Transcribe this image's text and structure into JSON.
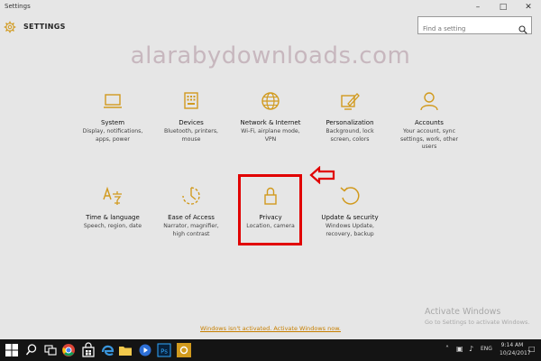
{
  "window": {
    "title": "Settings"
  },
  "header": {
    "title": "SETTINGS"
  },
  "search": {
    "placeholder": "Find a setting"
  },
  "watermark": "alarabydownloads.com",
  "accent": "#d19a1e",
  "tiles": [
    {
      "icon": "laptop-icon",
      "name": "System",
      "desc": [
        "Display, notifications,",
        "apps, power"
      ]
    },
    {
      "icon": "devices-icon",
      "name": "Devices",
      "desc": [
        "Bluetooth, printers,",
        "mouse"
      ]
    },
    {
      "icon": "globe-icon",
      "name": "Network & Internet",
      "desc": [
        "Wi-Fi, airplane mode,",
        "VPN"
      ]
    },
    {
      "icon": "personalization-icon",
      "name": "Personalization",
      "desc": [
        "Background, lock",
        "screen, colors"
      ]
    },
    {
      "icon": "person-icon",
      "name": "Accounts",
      "desc": [
        "Your account, sync",
        "settings, work, other",
        "users"
      ]
    },
    {
      "icon": "language-icon",
      "name": "Time & language",
      "desc": [
        "Speech, region, date"
      ]
    },
    {
      "icon": "ease-of-access-icon",
      "name": "Ease of Access",
      "desc": [
        "Narrator, magnifier,",
        "high contrast"
      ]
    },
    {
      "icon": "lock-icon",
      "name": "Privacy",
      "desc": [
        "Location, camera"
      ]
    },
    {
      "icon": "update-icon",
      "name": "Update & security",
      "desc": [
        "Windows Update,",
        "recovery, backup"
      ]
    }
  ],
  "activation": {
    "title": "Activate Windows",
    "subtitle": "Go to Settings to activate Windows.",
    "link": "Windows isn't activated. Activate Windows now."
  },
  "taskbar": {
    "lang": "ENG",
    "time": "9:14 AM",
    "date": "10/24/2017"
  }
}
